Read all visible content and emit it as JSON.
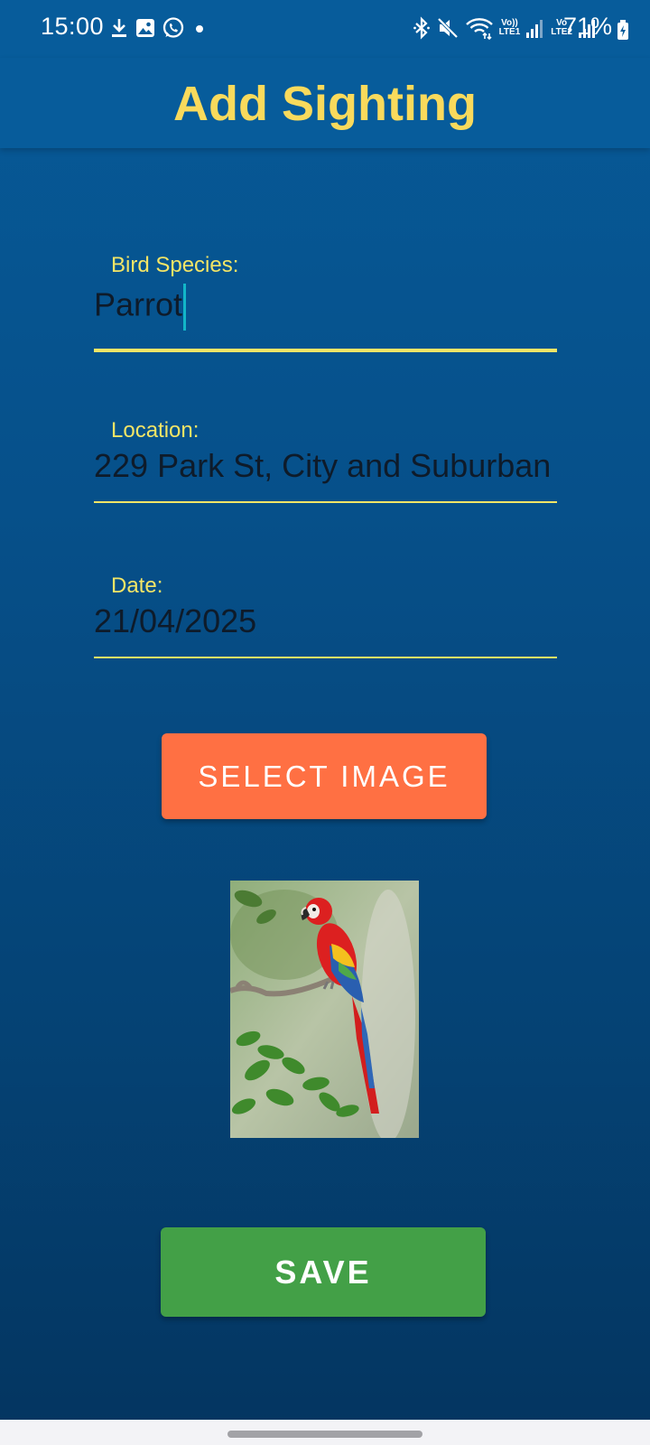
{
  "status_bar": {
    "time": "15:00",
    "left_icons": [
      "download-icon",
      "gallery-icon",
      "whatsapp-icon",
      "dot-icon"
    ],
    "right_icons": [
      "bluetooth-icon",
      "mute-icon",
      "wifi-icon",
      "signal-sim1-icon",
      "signal-sim2-icon"
    ],
    "volte1_top": "Vo))",
    "volte1_bottom": "LTE1",
    "volte2_top": "Vo",
    "volte2_bottom": "LTE2",
    "battery": "71%"
  },
  "app_bar": {
    "title": "Add Sighting"
  },
  "form": {
    "species_label": "Bird Species:",
    "species_value": "Parrot",
    "location_label": "Location:",
    "location_value": "229 Park St, City and Suburban",
    "date_label": "Date:",
    "date_value": "21/04/2025"
  },
  "buttons": {
    "select_image": "SELECT IMAGE",
    "save": "SAVE"
  },
  "image": {
    "subject": "scarlet-macaw-photo"
  },
  "colors": {
    "background": "#06508a",
    "app_bar": "#075c9b",
    "title": "#f9da5c",
    "label": "#f3e566",
    "select_button": "#ff7043",
    "save_button": "#43a047"
  }
}
